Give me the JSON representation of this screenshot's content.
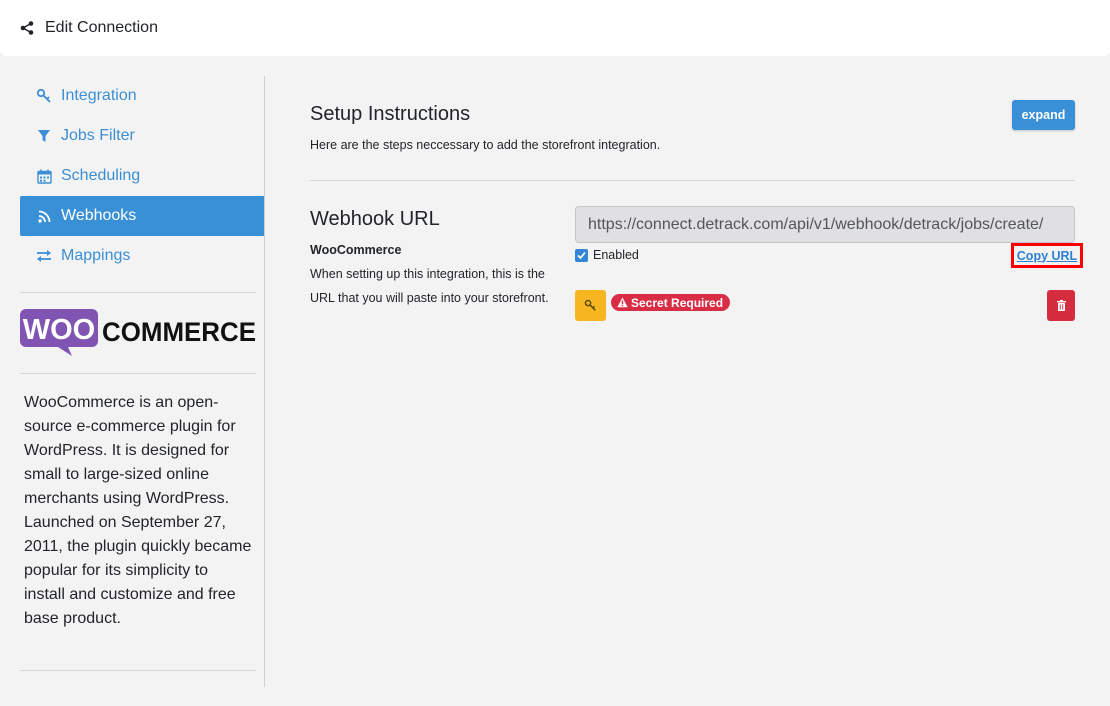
{
  "header": {
    "title": "Edit Connection",
    "icon": "share-icon"
  },
  "sidebar": {
    "items": [
      {
        "label": "Integration",
        "icon": "key-icon",
        "active": false
      },
      {
        "label": "Jobs Filter",
        "icon": "filter-icon",
        "active": false
      },
      {
        "label": "Scheduling",
        "icon": "calendar-icon",
        "active": false
      },
      {
        "label": "Webhooks",
        "icon": "rss-icon",
        "active": true
      },
      {
        "label": "Mappings",
        "icon": "exchange-icon",
        "active": false
      }
    ],
    "logo": {
      "word_left": "WOO",
      "word_right": "COMMERCE",
      "brand_color": "#7f54b3"
    },
    "about": "WooCommerce is an open-source e-commerce plugin for WordPress. It is designed for small to large-sized online merchants using WordPress. Launched on September 27, 2011, the plugin quickly became popular for its simplicity to install and customize and free base product."
  },
  "main": {
    "setup": {
      "title": "Setup Instructions",
      "description": "Here are the steps neccessary to add the storefront integration.",
      "expand_label": "expand"
    },
    "webhook": {
      "title": "Webhook URL",
      "platform": "WooCommerce",
      "description": "When setting up this integration, this is the URL that you will paste into your storefront.",
      "url": "https://connect.detrack.com/api/v1/webhook/detrack/jobs/create/",
      "enabled_label": "Enabled",
      "enabled": true,
      "copy_label": "Copy URL",
      "secret_badge": "Secret Required"
    }
  },
  "colors": {
    "accent": "#3990d6",
    "warning": "#f7b61f",
    "danger": "#d92c45",
    "highlight": "#ff0000"
  }
}
